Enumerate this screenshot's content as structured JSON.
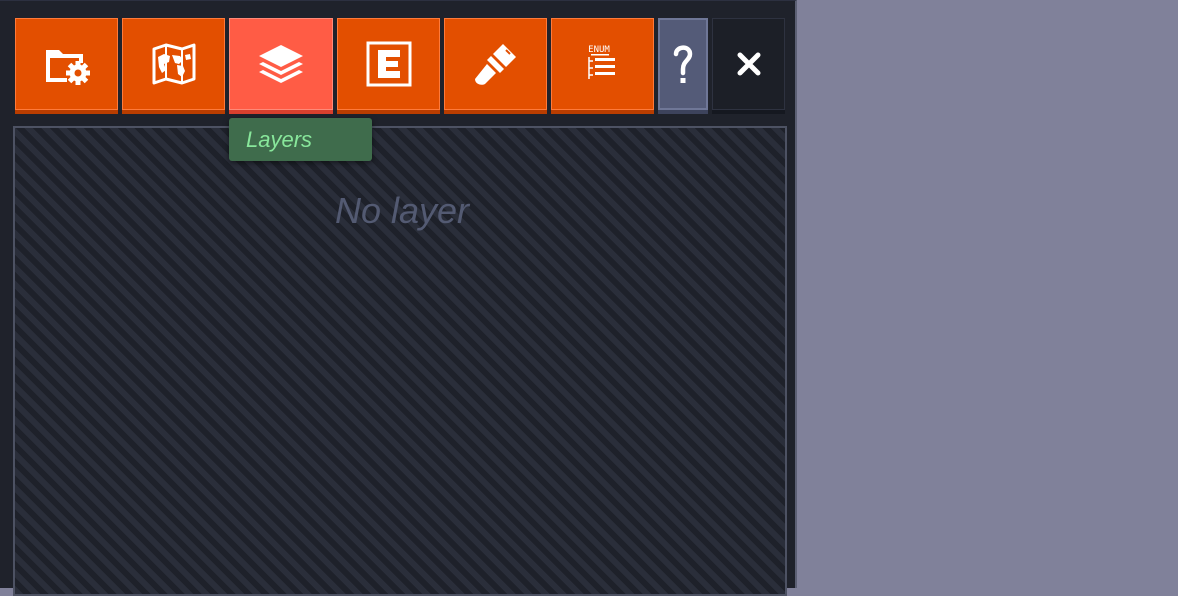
{
  "toolbar": {
    "buttons": [
      {
        "name": "folder-settings",
        "icon": "folder-gear-icon",
        "state": "normal"
      },
      {
        "name": "world-map",
        "icon": "world-map-icon",
        "state": "normal"
      },
      {
        "name": "layers",
        "icon": "layers-icon",
        "state": "active"
      },
      {
        "name": "entity",
        "icon": "entity-e-icon",
        "state": "normal"
      },
      {
        "name": "paint-brush",
        "icon": "paint-brush-icon",
        "state": "normal"
      },
      {
        "name": "enum-list",
        "icon": "enum-list-icon",
        "state": "normal",
        "label": "ENUM"
      },
      {
        "name": "help",
        "icon": "question-mark-icon",
        "state": "normal",
        "label": "?"
      },
      {
        "name": "close",
        "icon": "close-icon",
        "state": "normal",
        "label": "✕"
      }
    ]
  },
  "tooltip": {
    "text": "Layers"
  },
  "layers_panel": {
    "empty_text": "No layer"
  },
  "colors": {
    "button_orange": "#e34f00",
    "button_active": "#ff5c45",
    "button_help": "#545b78",
    "button_close": "#1c1f27",
    "panel_bg": "#1f222b",
    "backdrop": "#80819a",
    "tooltip_bg": "#3f6c4c",
    "tooltip_text": "#88e79b",
    "empty_text": "#535a72"
  }
}
